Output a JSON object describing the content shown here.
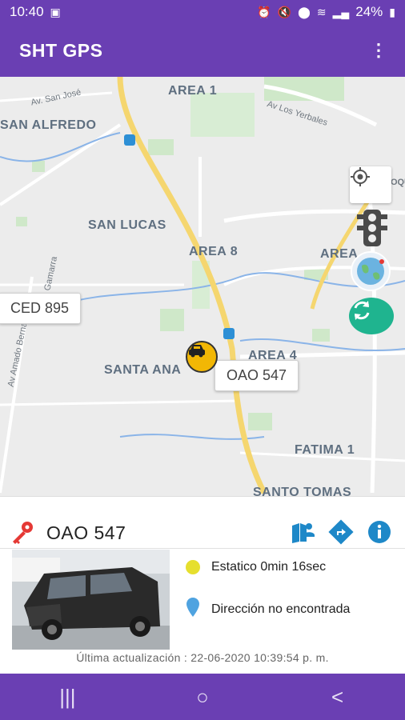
{
  "status_bar": {
    "time": "10:40",
    "battery": "24%"
  },
  "app_bar": {
    "title": "SHT GPS",
    "menu_icon": "more-vert-icon"
  },
  "map": {
    "areas": [
      "AREA 1",
      "SAN ALFREDO",
      "SAN LUCAS",
      "AREA 8",
      "AREA",
      "SANTA ANA",
      "AREA 4",
      "FATIMA 1",
      "SANTO TOMAS"
    ],
    "streets": [
      "Av. San José",
      "Av Los Yerbales",
      "Av Amado Bernal",
      "Gamarra",
      "ROQU"
    ],
    "callouts": {
      "ced": "CED 895",
      "oao": "OAO 547"
    },
    "controls": [
      "my-location-icon",
      "traffic-light-icon",
      "globe-icon",
      "refresh-icon"
    ]
  },
  "vehicle": {
    "plate": "OAO 547",
    "status_text": "Estatico 0min 16sec",
    "address_text": "Dirección no encontrada",
    "last_update": "Última actualización : 22-06-2020 10:39:54 p. m."
  },
  "actions": [
    "person-map-icon",
    "directions-icon",
    "info-icon"
  ],
  "colors": {
    "primary": "#6a3fb3",
    "accent": "#1fb48f",
    "marker": "#f2b705",
    "key": "#e53935",
    "action_blue": "#1e88c8"
  },
  "nav_bar": {
    "recents": "|||",
    "home": "○",
    "back": "<"
  }
}
